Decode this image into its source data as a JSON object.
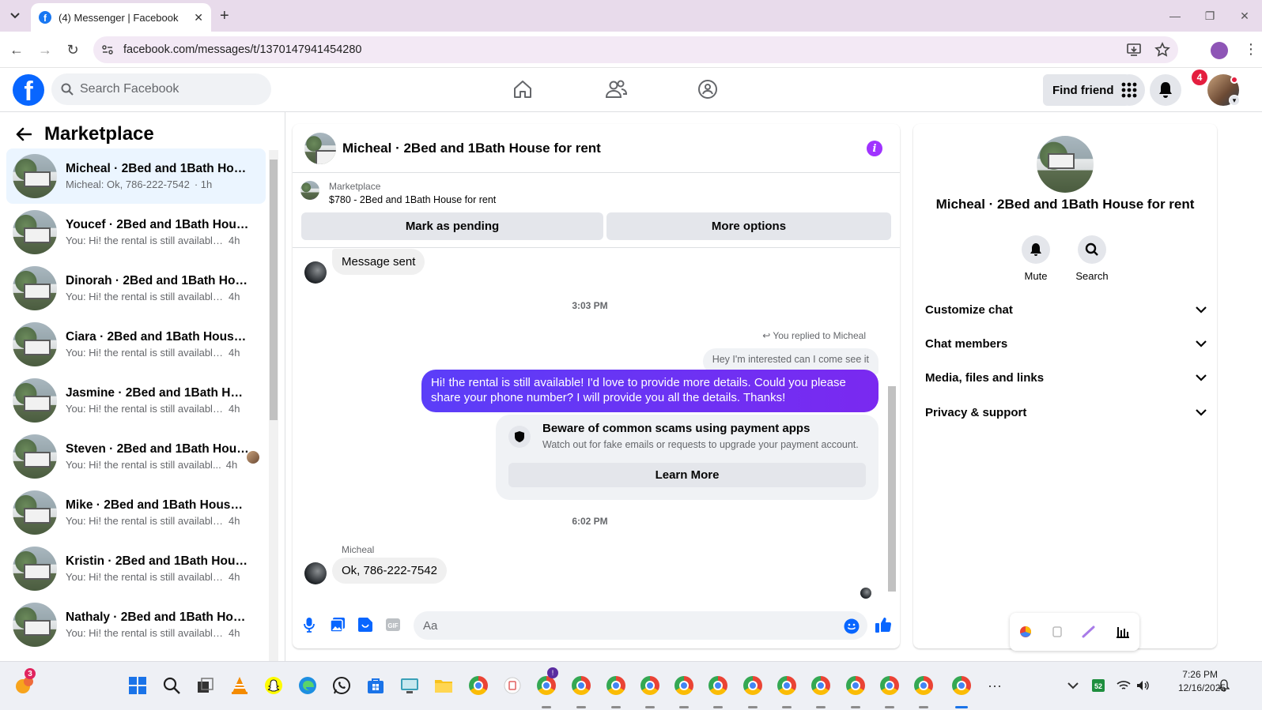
{
  "browser": {
    "tab_title": "(4) Messenger | Facebook",
    "url": "facebook.com/messages/t/1370147941454280"
  },
  "fb": {
    "search_placeholder": "Search Facebook",
    "find_friends": "Find friends",
    "notification_count": "4"
  },
  "left": {
    "title": "Marketplace",
    "conversations": [
      {
        "name": "Micheal · 2Bed and 1Bath House...",
        "preview": "Micheal: Ok, 786-222-7542",
        "time": "· 1h",
        "active": true
      },
      {
        "name": "Youcef · 2Bed and 1Bath House ...",
        "preview": "You: Hi! the rental is still available! I...",
        "time": "4h"
      },
      {
        "name": "Dinorah · 2Bed and 1Bath Hous...",
        "preview": "You: Hi! the rental is still available! I...",
        "time": "4h"
      },
      {
        "name": "Ciara · 2Bed and 1Bath House fo...",
        "preview": "You: Hi! the rental is still available! I...",
        "time": "4h"
      },
      {
        "name": "Jasmine · 2Bed and 1Bath House...",
        "preview": "You: Hi! the rental is still available! I...",
        "time": "4h"
      },
      {
        "name": "Steven · 2Bed and 1Bath Hous...",
        "preview": "You: Hi! the rental is still availabl...",
        "time": "4h"
      },
      {
        "name": "Mike · 2Bed and 1Bath House fo...",
        "preview": "You: Hi! the rental is still available! I...",
        "time": "4h"
      },
      {
        "name": "Kristin · 2Bed and 1Bath House f...",
        "preview": "You: Hi! the rental is still available! I...",
        "time": "4h"
      },
      {
        "name": "Nathaly · 2Bed and 1Bath House...",
        "preview": "You: Hi! the rental is still available! I...",
        "time": "4h"
      }
    ]
  },
  "chat": {
    "title": "Micheal · 2Bed and 1Bath House for rent",
    "marketplace_label": "Marketplace",
    "listing": "$780 - 2Bed and 1Bath House for rent",
    "mark_pending": "Mark as pending",
    "more_options": "More options",
    "msg1": "Message sent",
    "time1": "3:03 PM",
    "replied": "You replied to Micheal",
    "quoted": "Hey I'm interested can I come see it",
    "sent": "Hi! the rental is still available! I'd love to provide more details. Could you please share your phone number? I will provide you all the details. Thanks!",
    "scam_title": "Beware of common scams using payment apps",
    "scam_desc": "Watch out for fake emails or requests to upgrade your payment account.",
    "learn_more": "Learn More",
    "time2": "6:02 PM",
    "sender": "Micheal",
    "msg2": "Ok, 786-222-7542",
    "input_placeholder": "Aa"
  },
  "right": {
    "name": "Micheal · 2Bed and 1Bath House for rent",
    "mute": "Mute",
    "search": "Search",
    "sections": [
      "Customize chat",
      "Chat members",
      "Media, files and links",
      "Privacy & support"
    ]
  },
  "taskbar": {
    "time": "7:26 PM",
    "date": "12/16/2025",
    "weather_badge": "3"
  },
  "colors": {
    "fb_blue": "#0866ff",
    "messenger_purple": "#6632f5",
    "notif_red": "#e41e3f"
  }
}
